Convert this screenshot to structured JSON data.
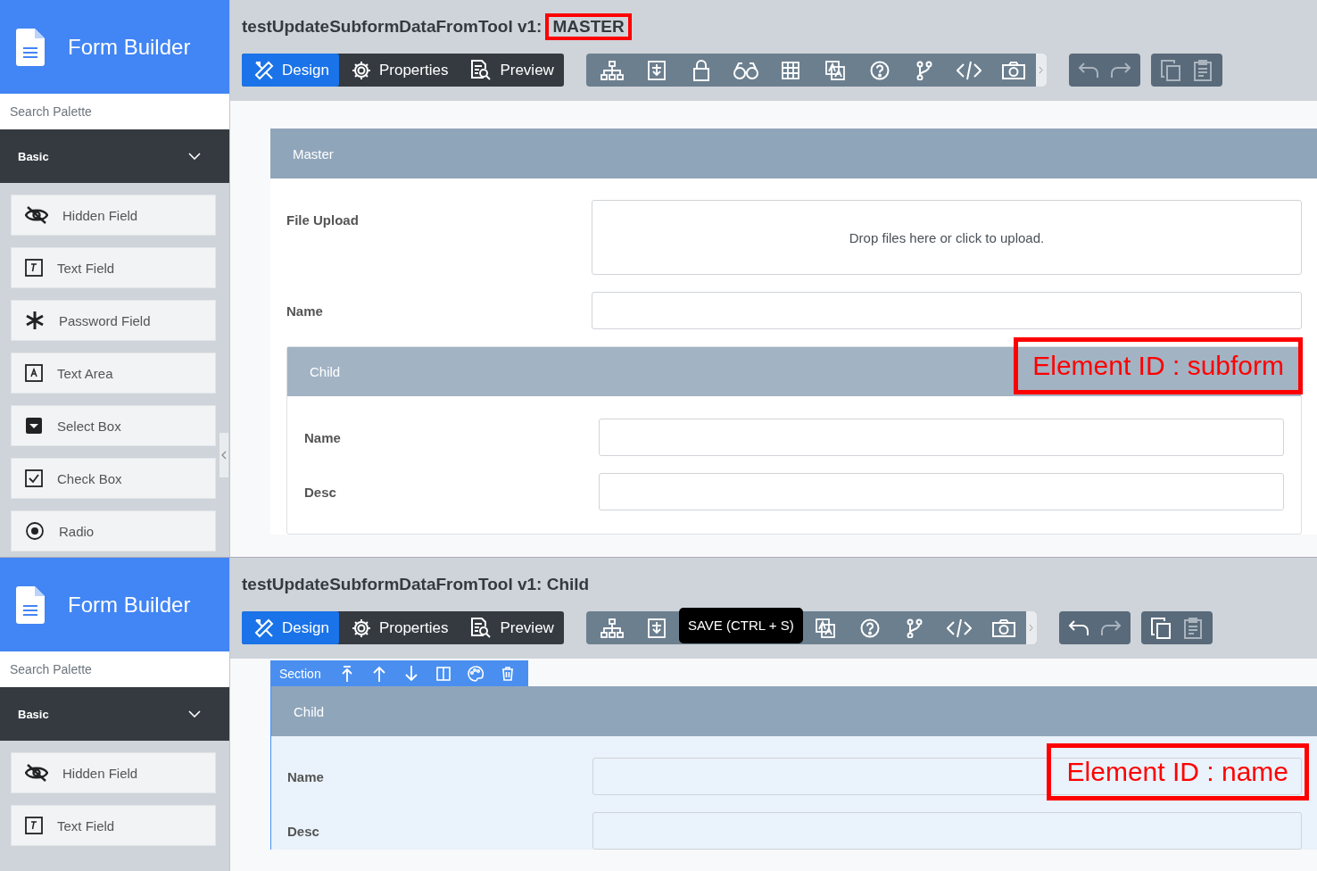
{
  "screens": [
    {
      "app_title": "Form Builder",
      "search": {
        "placeholder": "Search Palette"
      },
      "category": {
        "label": "Basic",
        "expanded": true
      },
      "palette": [
        {
          "label": "Hidden Field",
          "kind": "hidden"
        },
        {
          "label": "Text Field",
          "kind": "text"
        },
        {
          "label": "Password Field",
          "kind": "password"
        },
        {
          "label": "Text Area",
          "kind": "textarea"
        },
        {
          "label": "Select Box",
          "kind": "select"
        },
        {
          "label": "Check Box",
          "kind": "checkbox"
        },
        {
          "label": "Radio",
          "kind": "radio"
        }
      ],
      "title": {
        "text": "testUpdateSubformDataFromTool v1:",
        "suffix": "MASTER",
        "suffix_highlighted": true
      },
      "tabs": [
        {
          "label": "Design",
          "kind": "design",
          "selected": true
        },
        {
          "label": "Properties",
          "kind": "properties",
          "selected": false
        },
        {
          "label": "Preview",
          "kind": "preview",
          "selected": false
        }
      ],
      "tools": [
        {
          "kind": "tree"
        },
        {
          "kind": "save"
        },
        {
          "kind": "lock"
        },
        {
          "kind": "binoculars"
        },
        {
          "kind": "grid"
        },
        {
          "kind": "translate"
        },
        {
          "kind": "help"
        },
        {
          "kind": "branch"
        },
        {
          "kind": "code"
        },
        {
          "kind": "camera"
        }
      ],
      "history": [
        {
          "kind": "undo",
          "disabled": true
        },
        {
          "kind": "redo",
          "disabled": true
        }
      ],
      "clipboard": [
        {
          "kind": "copy",
          "disabled": true
        },
        {
          "kind": "paste",
          "disabled": true
        }
      ],
      "section": {
        "title": "Master",
        "selected": false,
        "fields": [
          {
            "kind": "upload",
            "label": "File Upload",
            "hint": "Drop files here or click to upload."
          },
          {
            "kind": "text",
            "label": "Name"
          },
          {
            "kind": "subform",
            "title": "Child",
            "annotation": "Element ID : subform",
            "fields": [
              {
                "kind": "text",
                "label": "Name"
              },
              {
                "kind": "text",
                "label": "Desc"
              }
            ]
          }
        ]
      }
    },
    {
      "app_title": "Form Builder",
      "search": {
        "placeholder": "Search Palette"
      },
      "category": {
        "label": "Basic",
        "expanded": true
      },
      "palette": [
        {
          "label": "Hidden Field",
          "kind": "hidden"
        },
        {
          "label": "Text Field",
          "kind": "text"
        }
      ],
      "title": {
        "text": "testUpdateSubformDataFromTool v1: Child"
      },
      "tabs": [
        {
          "label": "Design",
          "kind": "design",
          "selected": true
        },
        {
          "label": "Properties",
          "kind": "properties",
          "selected": false
        },
        {
          "label": "Preview",
          "kind": "preview",
          "selected": false
        }
      ],
      "tools": [
        {
          "kind": "tree"
        },
        {
          "kind": "save"
        },
        {
          "kind": "tooltip",
          "text": "SAVE (CTRL + S)"
        },
        {
          "kind": "translate"
        },
        {
          "kind": "help"
        },
        {
          "kind": "branch"
        },
        {
          "kind": "code"
        },
        {
          "kind": "camera"
        }
      ],
      "history": [
        {
          "kind": "undo",
          "disabled": false
        },
        {
          "kind": "redo",
          "disabled": true
        }
      ],
      "clipboard": [
        {
          "kind": "copy",
          "disabled": false
        },
        {
          "kind": "paste",
          "disabled": true
        }
      ],
      "section_toolbar": {
        "label": "Section",
        "actions": [
          {
            "kind": "move-top"
          },
          {
            "kind": "up"
          },
          {
            "kind": "down"
          },
          {
            "kind": "columns"
          },
          {
            "kind": "palette"
          },
          {
            "kind": "delete"
          }
        ]
      },
      "section": {
        "title": "Child",
        "selected": true,
        "fields": [
          {
            "kind": "text",
            "label": "Name",
            "annotation": "Element ID : name"
          },
          {
            "kind": "text",
            "label": "Desc"
          }
        ]
      }
    }
  ]
}
